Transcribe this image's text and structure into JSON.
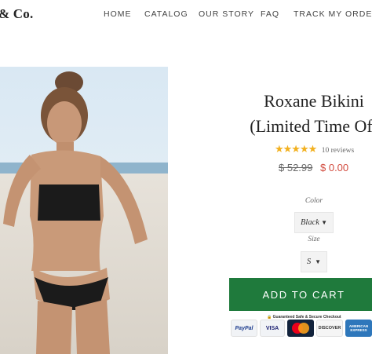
{
  "header": {
    "brand": "& Co.",
    "nav": [
      "HOME",
      "CATALOG",
      "OUR STORY",
      "FAQ",
      "TRACK MY ORDER"
    ]
  },
  "product": {
    "title_line1": "Roxane Bikini",
    "title_line2": "(Limited Time Off",
    "rating": {
      "stars": "★★★★★",
      "value": 5,
      "reviews_text": "10 reviews"
    },
    "price_original": "$ 52.99",
    "price_sale": "$ 0.00",
    "color_label": "Color",
    "color_value": "Black",
    "size_label": "Size",
    "size_value": "S",
    "add_to_cart": "ADD TO CART",
    "secure_text": "Guaranteed Safe & Secure Checkout",
    "payment_methods": [
      "PayPal",
      "VISA",
      "Mastercard",
      "DISCOVER",
      "AMERICAN EXPRESS"
    ]
  },
  "colors": {
    "accent_green": "#1f7a3c",
    "sale_red": "#d24b3e",
    "star_gold": "#f2b01e"
  }
}
